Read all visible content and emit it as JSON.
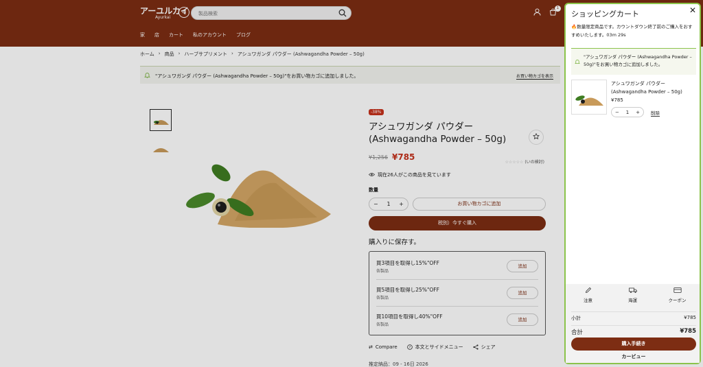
{
  "header": {
    "logo_text": "アーユルカイ",
    "logo_sub": "Ayurkai",
    "search_placeholder": "製品検索",
    "cart_count": "1",
    "nav": [
      "家",
      "店",
      "カート",
      "私のアカウント",
      "ブログ"
    ]
  },
  "breadcrumb": [
    "ホーム",
    "›",
    "商品",
    "›",
    "ハーブサプリメント",
    "›",
    "アシュワガンダ パウダー (Ashwagandha Powder – 50g)"
  ],
  "notice": {
    "text": "\"アシュワガンダ パウダー (Ashwagandha Powder – 50g)\"をお買い物カゴに追加しました。",
    "button": "お買い物カゴを表示"
  },
  "product": {
    "discount": "-38%",
    "title": "アシュワガンダ パウダー (Ashwagandha Powder – 50g)",
    "old_price": "¥1,256",
    "price": "¥785",
    "rating_text": "(いの検討)",
    "rating_stars": 0,
    "viewing": "現在26人がこの商品を見ています",
    "qty_label": "数量",
    "qty": "1",
    "add_to_cart": "お買い物カゴに追加",
    "buy_now": "税別）今すぐ購入",
    "bundle_title": "購入りに保存す。",
    "bundles": [
      {
        "title": "買3項目を取得し15%\"OFF",
        "sub": "各製品",
        "btn": "追加"
      },
      {
        "title": "買5項目を取得し25%\"OFF",
        "sub": "各製品",
        "btn": "追加"
      },
      {
        "title": "買10項目を取得し40%\"OFF",
        "sub": "各製品",
        "btn": "追加"
      }
    ],
    "links": [
      "Compare",
      "本文とサイドメニュー",
      "シェア"
    ],
    "bottom_line": "推定納品：09 - 16日 2026"
  },
  "drawer": {
    "title": "ショッピングカート",
    "countdown_msg": "数量限定商品です。カウントダウン終了前のご購入をおすすめいたします。03m 29s",
    "notice": "\"アシュワガンダ パウダー (Ashwagandha Powder – 50g)\"をお買い物カゴに追加しました。",
    "item": {
      "name": "アシュワガンダ パウダー (Ashwagandha Powder – 50g)",
      "price": "¥785",
      "qty": "1",
      "remove": "削除"
    },
    "tools": [
      "注意",
      "海運",
      "クーポン"
    ],
    "subtotal_label": "小計",
    "subtotal": "¥785",
    "total_label": "合計",
    "total": "¥785",
    "checkout": "購入手続き",
    "view_cart": "カービュー"
  },
  "colors": {
    "brand": "#7d2d13",
    "sale": "#c5311c",
    "drawer_border": "#8bc34a"
  }
}
